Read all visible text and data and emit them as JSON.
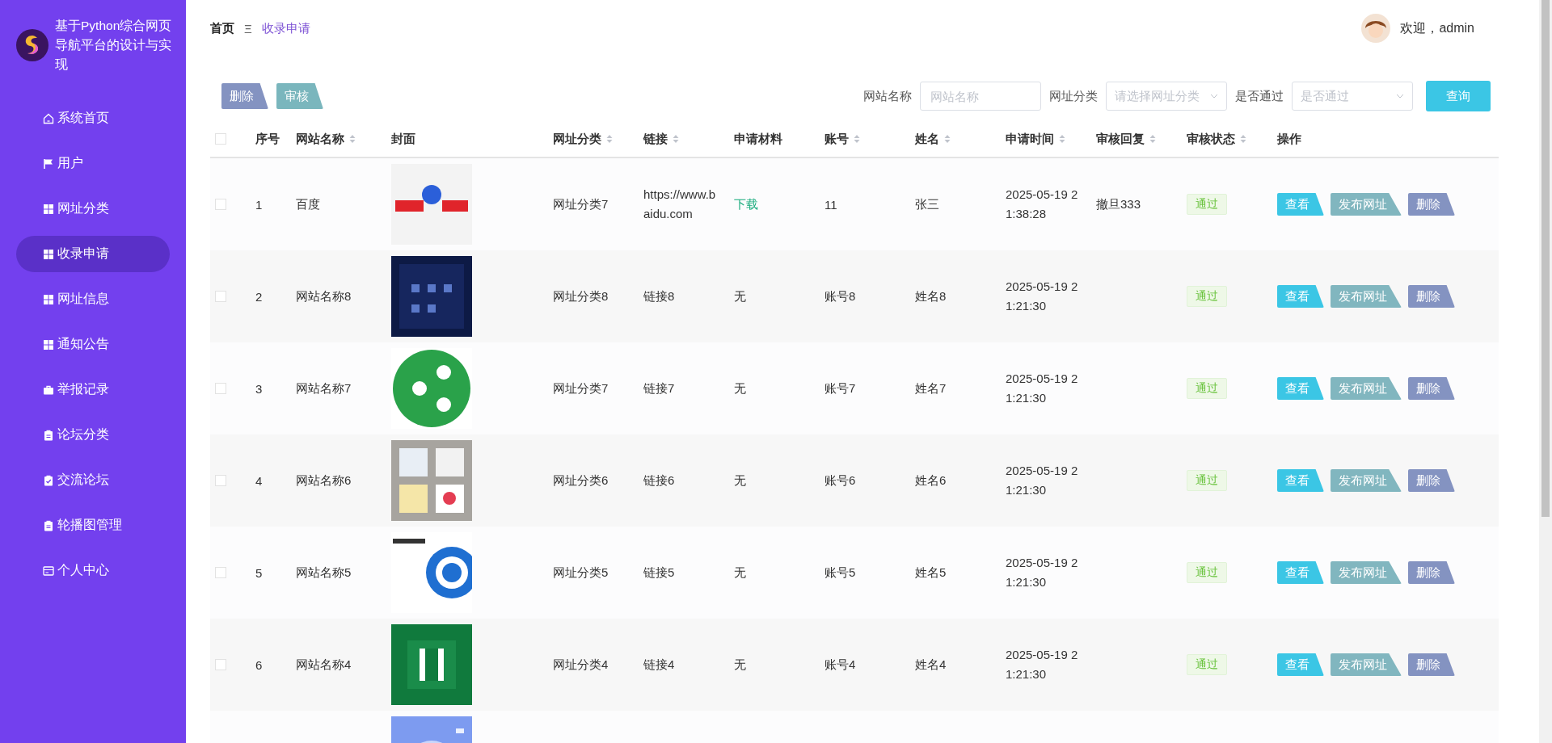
{
  "sidebar": {
    "title": "基于Python综合网页导航平台的设计与实现",
    "items": [
      {
        "label": "系统首页",
        "selected": false
      },
      {
        "label": "用户",
        "selected": false
      },
      {
        "label": "网址分类",
        "selected": false
      },
      {
        "label": "收录申请",
        "selected": true
      },
      {
        "label": "网址信息",
        "selected": false
      },
      {
        "label": "通知公告",
        "selected": false
      },
      {
        "label": "举报记录",
        "selected": false
      },
      {
        "label": "论坛分类",
        "selected": false
      },
      {
        "label": "交流论坛",
        "selected": false
      },
      {
        "label": "轮播图管理",
        "selected": false
      },
      {
        "label": "个人中心",
        "selected": false
      }
    ]
  },
  "breadcrumb": {
    "home": "首页",
    "separator": "Ξ",
    "current": "收录申请"
  },
  "user": {
    "greeting": "欢迎，admin"
  },
  "toolbar": {
    "buttons": [
      "删除",
      "审核"
    ],
    "filters": [
      {
        "label": "网站名称",
        "kind": "input",
        "placeholder": "网站名称"
      },
      {
        "label": "网址分类",
        "kind": "select",
        "placeholder": "请选择网址分类"
      },
      {
        "label": "是否通过",
        "kind": "select",
        "placeholder": "是否通过"
      }
    ],
    "search_button": "查询"
  },
  "table": {
    "all_checked": false,
    "columns": [
      {
        "label": "序号",
        "sortable": false
      },
      {
        "label": "网站名称",
        "sortable": true
      },
      {
        "label": "封面",
        "sortable": false
      },
      {
        "label": "网址分类",
        "sortable": true
      },
      {
        "label": "链接",
        "sortable": true
      },
      {
        "label": "申请材料",
        "sortable": false
      },
      {
        "label": "账号",
        "sortable": true
      },
      {
        "label": "姓名",
        "sortable": true
      },
      {
        "label": "申请时间",
        "sortable": true
      },
      {
        "label": "审核回复",
        "sortable": true
      },
      {
        "label": "审核状态",
        "sortable": true
      },
      {
        "label": "操作",
        "sortable": false
      }
    ],
    "rows": [
      {
        "checked": false,
        "index": "1",
        "name": "百度",
        "cover": {
          "kind": "picture"
        },
        "category": "网址分类7",
        "link": "https://www.baidu.com",
        "material": {
          "text": "下载",
          "kind": "link"
        },
        "account": "11",
        "person": "张三",
        "time": "2025-05-19 21:38:28",
        "reply": "撤旦333",
        "status": "通过",
        "actions": [
          "查看",
          "发布网址",
          "删除"
        ]
      },
      {
        "checked": false,
        "index": "2",
        "name": "网站名称8",
        "cover": {
          "kind": "picture"
        },
        "category": "网址分类8",
        "link": "链接8",
        "material": {
          "text": "无",
          "kind": "text"
        },
        "account": "账号8",
        "person": "姓名8",
        "time": "2025-05-19 21:21:30",
        "status": "通过",
        "actions": [
          "查看",
          "发布网址",
          "删除"
        ]
      },
      {
        "checked": false,
        "index": "3",
        "name": "网站名称7",
        "cover": {
          "kind": "picture"
        },
        "category": "网址分类7",
        "link": "链接7",
        "material": {
          "text": "无",
          "kind": "text"
        },
        "account": "账号7",
        "person": "姓名7",
        "time": "2025-05-19 21:21:30",
        "status": "通过",
        "actions": [
          "查看",
          "发布网址",
          "删除"
        ]
      },
      {
        "checked": false,
        "index": "4",
        "name": "网站名称6",
        "cover": {
          "kind": "picture"
        },
        "category": "网址分类6",
        "link": "链接6",
        "material": {
          "text": "无",
          "kind": "text"
        },
        "account": "账号6",
        "person": "姓名6",
        "time": "2025-05-19 21:21:30",
        "status": "通过",
        "actions": [
          "查看",
          "发布网址",
          "删除"
        ]
      },
      {
        "checked": false,
        "index": "5",
        "name": "网站名称5",
        "cover": {
          "kind": "picture"
        },
        "category": "网址分类5",
        "link": "链接5",
        "material": {
          "text": "无",
          "kind": "text"
        },
        "account": "账号5",
        "person": "姓名5",
        "time": "2025-05-19 21:21:30",
        "status": "通过",
        "actions": [
          "查看",
          "发布网址",
          "删除"
        ]
      },
      {
        "checked": false,
        "index": "6",
        "name": "网站名称4",
        "cover": {
          "kind": "picture"
        },
        "category": "网址分类4",
        "link": "链接4",
        "material": {
          "text": "无",
          "kind": "text"
        },
        "account": "账号4",
        "person": "姓名4",
        "time": "2025-05-19 21:21:30",
        "status": "通过",
        "actions": [
          "查看",
          "发布网址",
          "删除"
        ]
      },
      {
        "cover": {
          "kind": "picture"
        }
      }
    ]
  }
}
